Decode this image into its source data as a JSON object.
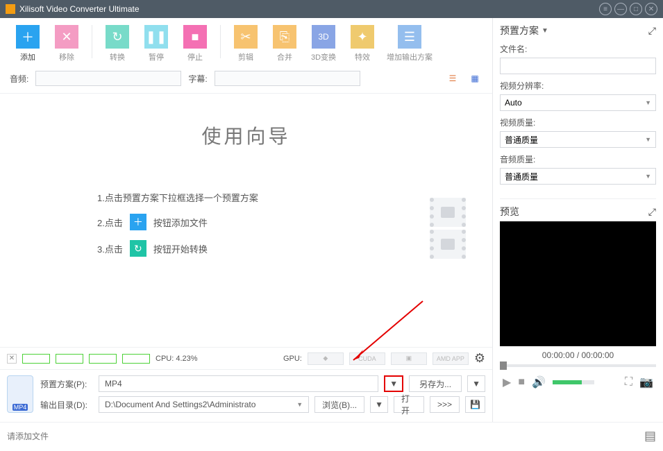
{
  "title": "Xilisoft Video Converter Ultimate",
  "toolbar": {
    "add": "添加",
    "remove": "移除",
    "convert": "转换",
    "pause": "暂停",
    "stop": "停止",
    "cut": "剪辑",
    "merge": "合并",
    "d3d": "3D变换",
    "effect": "特效",
    "addProfile": "增加输出方案"
  },
  "subrow": {
    "audio": "音频:",
    "subtitle": "字幕:"
  },
  "wizard": {
    "title": "使用向导",
    "step1_pre": "1.点击预置方案下拉框选择一个预置方案",
    "step2_pre": "2.点击",
    "step2_post": "按钮添加文件",
    "step3_pre": "3.点击",
    "step3_post": "按钮开始转换"
  },
  "status": {
    "cpu": "CPU: 4.23%",
    "gpu": "GPU:",
    "cuda": "CUDA",
    "amd": "AMD APP"
  },
  "bottom": {
    "profileLabel": "预置方案(P):",
    "profileValue": "MP4",
    "saveAs": "另存为...",
    "outputLabel": "输出目录(D):",
    "outputValue": "D:\\Document And Settings2\\Administrato",
    "browse": "浏览(B)...",
    "open": "打开",
    "extra": ">>>"
  },
  "footer": {
    "hint": "请添加文件"
  },
  "right": {
    "preset": "预置方案",
    "fileName": "文件名:",
    "resolution": "视频分辨率:",
    "resolutionVal": "Auto",
    "vquality": "视频质量:",
    "vqualityVal": "普通质量",
    "aquality": "音频质量:",
    "aqualityVal": "普通质量",
    "preview": "预览",
    "timecode": "00:00:00 / 00:00:00"
  }
}
